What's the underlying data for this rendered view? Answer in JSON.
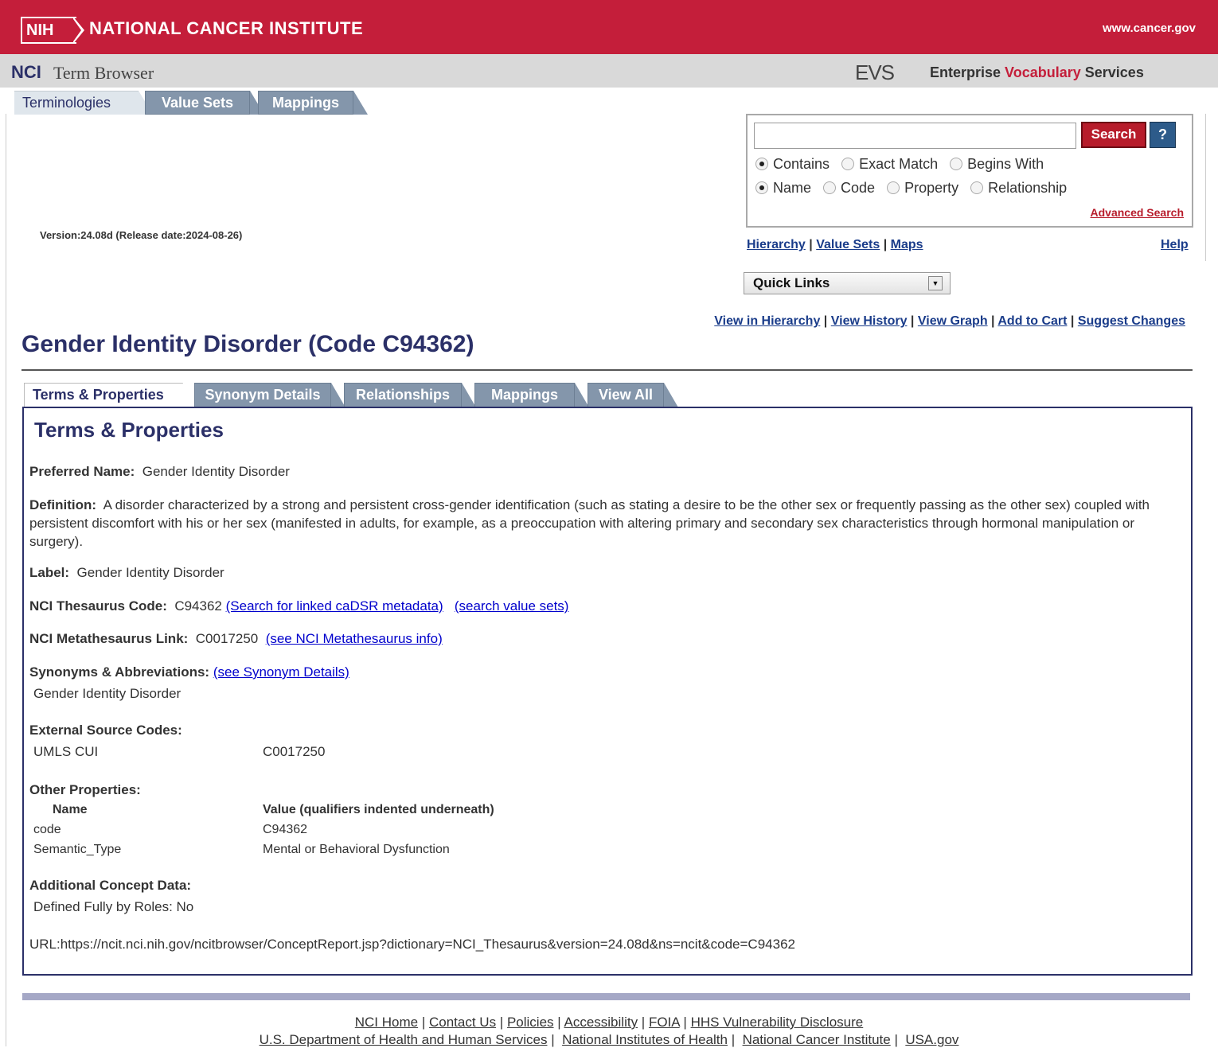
{
  "banner": {
    "logo": "NIH",
    "title": "NATIONAL CANCER INSTITUTE",
    "site": "www.cancer.gov"
  },
  "header": {
    "nci": "NCI",
    "term_browser": "Term Browser",
    "evs_logo": "EVS",
    "evs_text_1": "Enterprise ",
    "evs_text_2": "Vocabulary",
    "evs_text_3": " Services"
  },
  "top_tabs": [
    "Terminologies",
    "Value Sets",
    "Mappings"
  ],
  "version": "Version:24.08d (Release date:2024-08-26)",
  "search": {
    "value": "",
    "button": "Search",
    "help": "?",
    "match_options": [
      "Contains",
      "Exact Match",
      "Begins With"
    ],
    "match_selected": "Contains",
    "field_options": [
      "Name",
      "Code",
      "Property",
      "Relationship"
    ],
    "field_selected": "Name",
    "advanced": "Advanced Search"
  },
  "nav": {
    "hierarchy": "Hierarchy",
    "value_sets": "Value Sets",
    "maps": "Maps",
    "help": "Help"
  },
  "quick_links": "Quick Links",
  "concept_links": [
    "View in Hierarchy",
    "View History",
    "View Graph",
    "Add to Cart",
    "Suggest Changes"
  ],
  "title": "Gender Identity Disorder (Code C94362)",
  "concept_tabs": [
    "Terms & Properties",
    "Synonym Details",
    "Relationships",
    "Mappings",
    "View All"
  ],
  "panel": {
    "heading": "Terms & Properties",
    "preferred_name_label": "Preferred Name:",
    "preferred_name": "Gender Identity Disorder",
    "definition_label": "Definition:",
    "definition": "A disorder characterized by a strong and persistent cross-gender identification (such as stating a desire to be the other sex or frequently passing as the other sex) coupled with persistent discomfort with his or her sex (manifested in adults, for example, as a preoccupation with altering primary and secondary sex characteristics through hormonal manipulation or surgery).",
    "label_label": "Label:",
    "label": "Gender Identity Disorder",
    "ncit_code_label": "NCI Thesaurus Code:",
    "ncit_code": "C94362",
    "cadsr_link": "(Search for linked caDSR metadata)",
    "value_sets_link": "(search value sets)",
    "meta_label": "NCI Metathesaurus Link:",
    "meta_code": "C0017250",
    "meta_link": "(see NCI Metathesaurus info)",
    "synonyms_label": "Synonyms & Abbreviations:",
    "synonyms_link": "(see Synonym Details)",
    "synonym": "Gender Identity Disorder",
    "external_label": "External Source Codes:",
    "external_source": "UMLS CUI",
    "external_code": "C0017250",
    "other_label": "Other Properties:",
    "other_col_name": "Name",
    "other_col_value": "Value (qualifiers indented underneath)",
    "other_rows": [
      {
        "name": "code",
        "value": "C94362"
      },
      {
        "name": "Semantic_Type",
        "value": "Mental or Behavioral Dysfunction"
      }
    ],
    "additional_label": "Additional Concept Data:",
    "additional_value": "Defined Fully by Roles: No",
    "url": "URL:https://ncit.nci.nih.gov/ncitbrowser/ConceptReport.jsp?dictionary=NCI_Thesaurus&version=24.08d&ns=ncit&code=C94362"
  },
  "footer": {
    "line1": [
      "NCI Home",
      "Contact Us",
      "Policies",
      "Accessibility",
      "FOIA",
      "HHS Vulnerability Disclosure"
    ],
    "line2": [
      "U.S. Department of Health and Human Services",
      "National Institutes of Health",
      "National Cancer Institute",
      "USA.gov"
    ]
  }
}
